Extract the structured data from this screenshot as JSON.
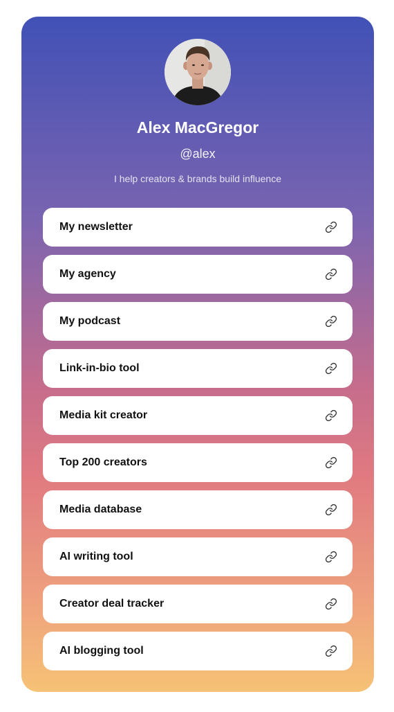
{
  "profile": {
    "name": "Alex MacGregor",
    "handle": "@alex",
    "bio": "I help creators & brands build influence"
  },
  "links": [
    {
      "label": "My newsletter",
      "icon": "link-icon"
    },
    {
      "label": "My agency",
      "icon": "link-icon"
    },
    {
      "label": "My podcast",
      "icon": "link-icon"
    },
    {
      "label": "Link-in-bio tool",
      "icon": "link-icon"
    },
    {
      "label": "Media kit creator",
      "icon": "link-icon"
    },
    {
      "label": "Top 200 creators",
      "icon": "link-icon"
    },
    {
      "label": "Media database",
      "icon": "link-icon"
    },
    {
      "label": "AI writing tool",
      "icon": "link-icon"
    },
    {
      "label": "Creator deal tracker",
      "icon": "link-icon"
    },
    {
      "label": "AI blogging tool",
      "icon": "link-icon"
    }
  ],
  "colors": {
    "gradient_top": "#4151b6",
    "gradient_mid": "#e07a80",
    "gradient_bottom": "#f6c276",
    "link_background": "#ffffff",
    "link_text": "#111111"
  }
}
